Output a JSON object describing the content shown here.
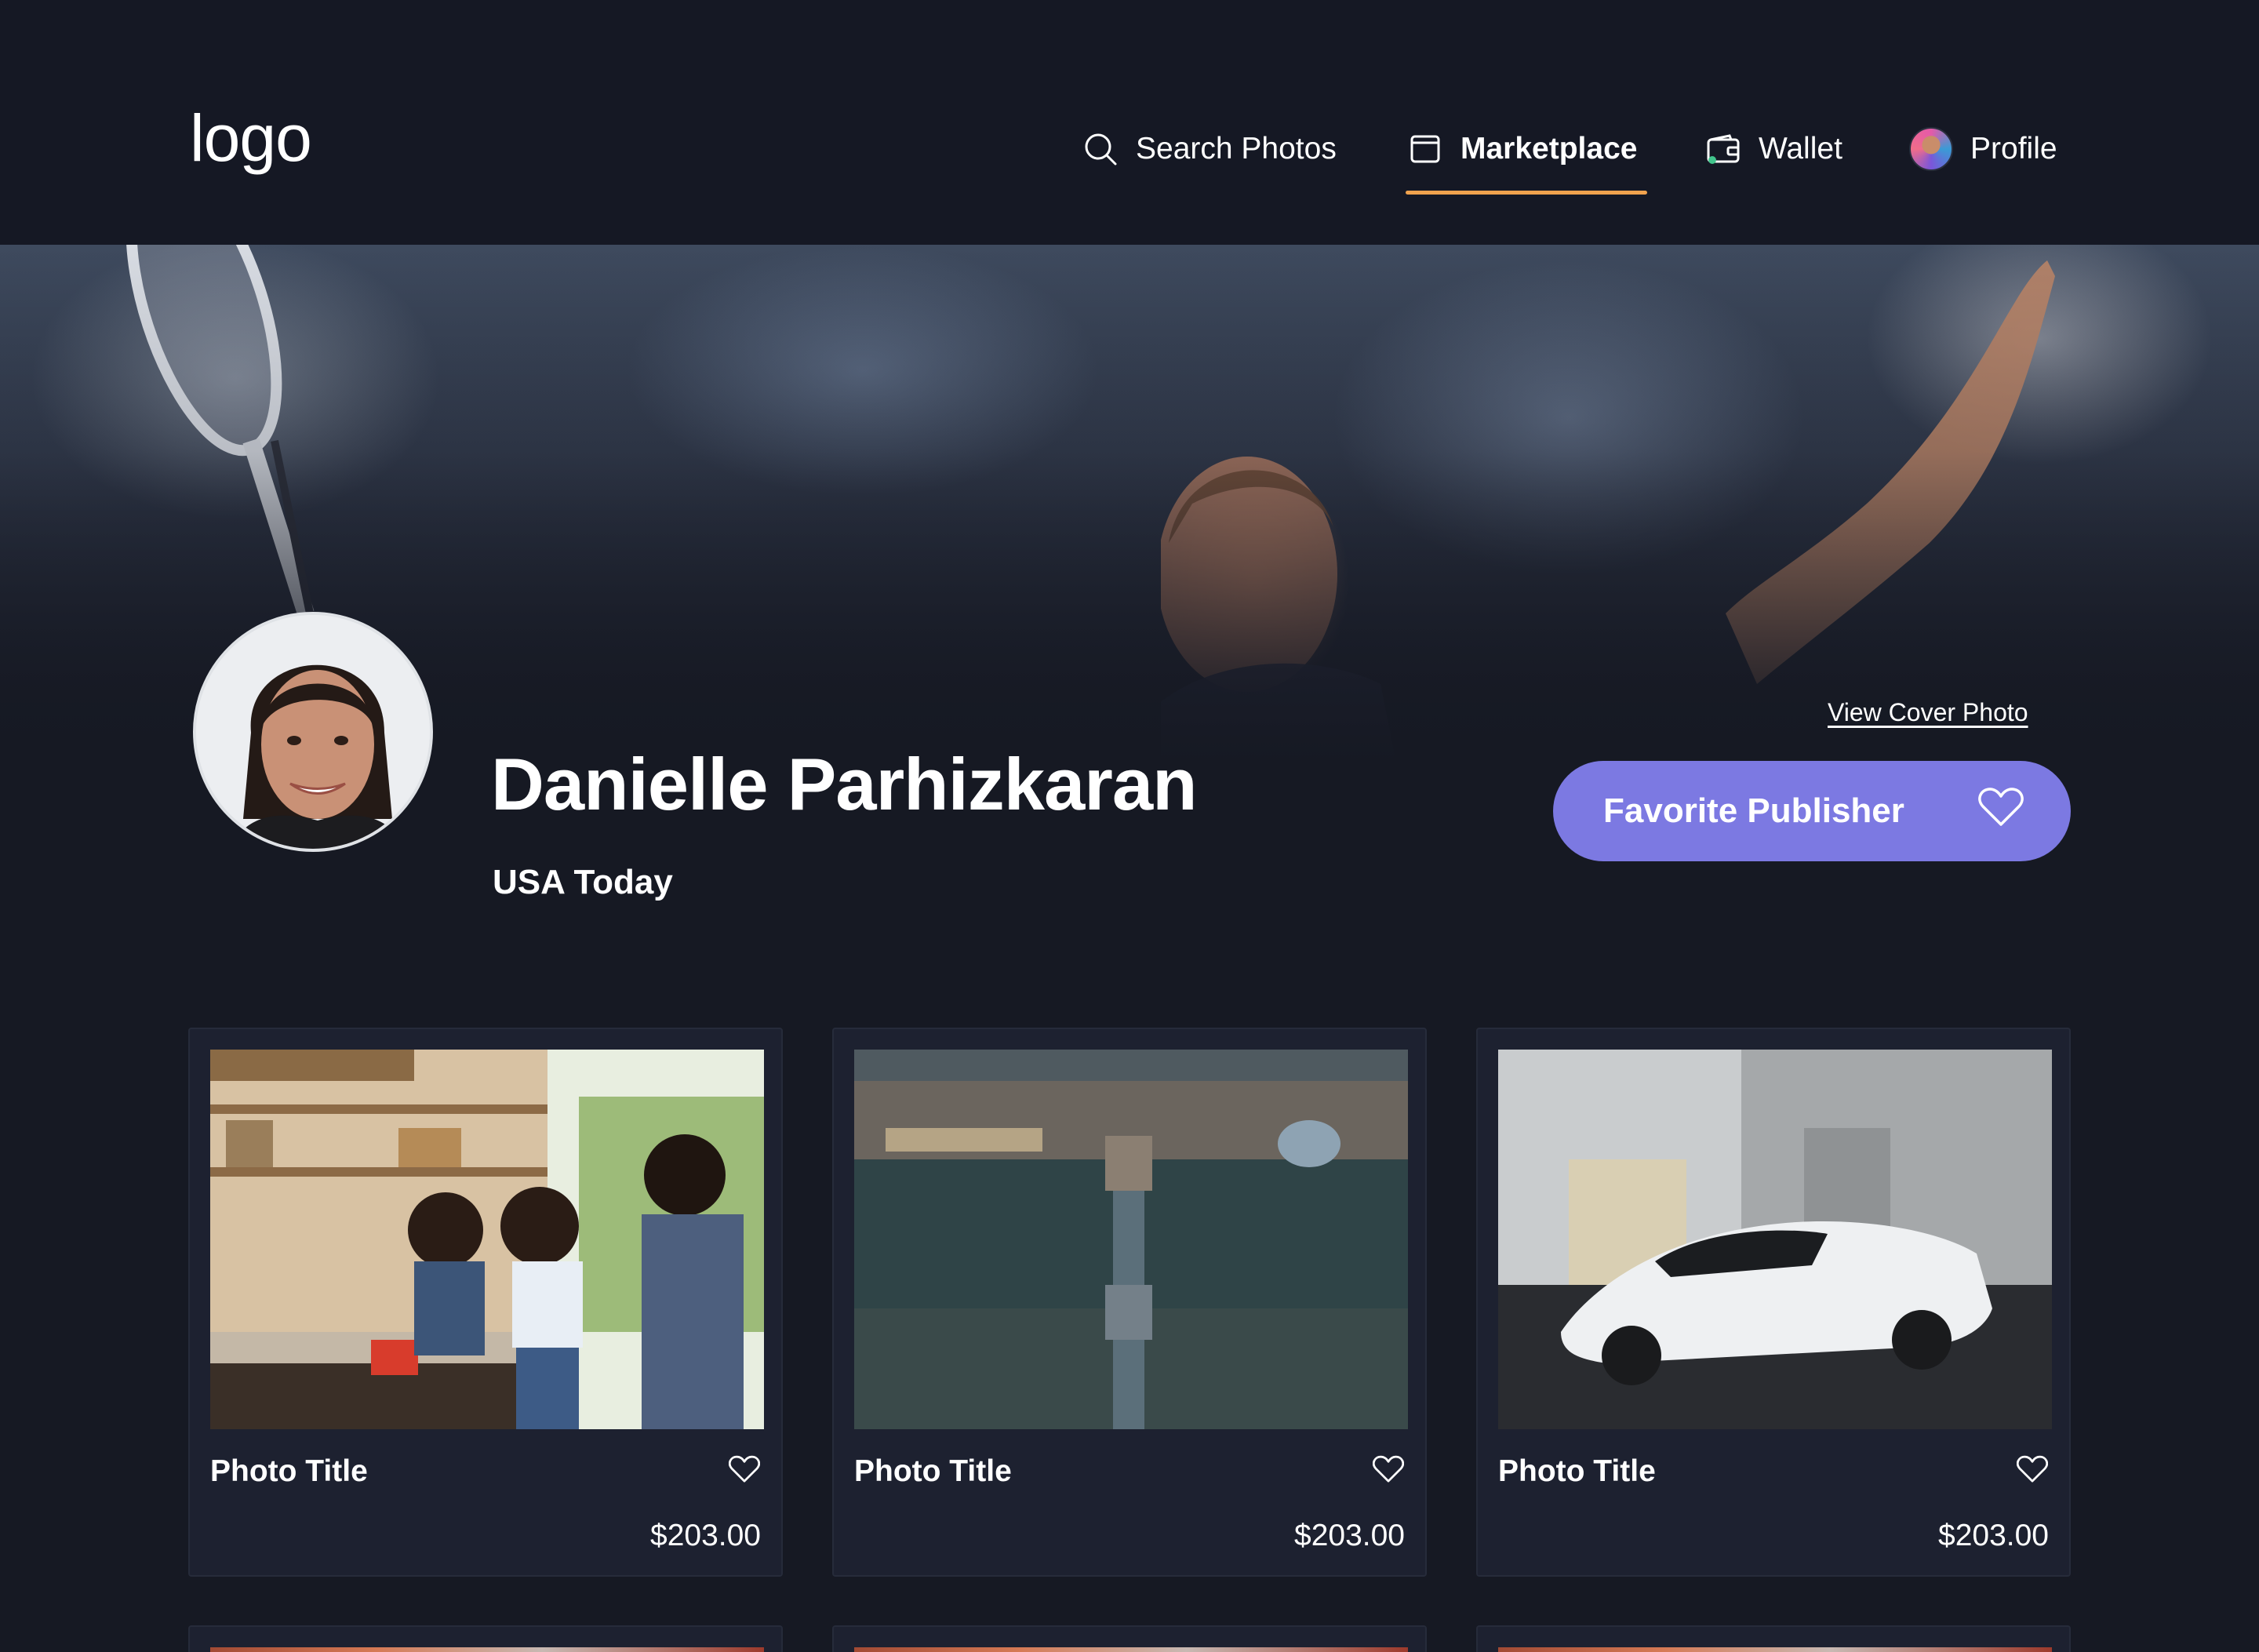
{
  "header": {
    "logo": "logo",
    "nav": [
      {
        "label": "Search Photos",
        "icon": "search-icon",
        "active": false
      },
      {
        "label": "Marketplace",
        "icon": "marketplace-icon",
        "active": true
      },
      {
        "label": "Wallet",
        "icon": "wallet-icon",
        "active": false
      },
      {
        "label": "Profile",
        "icon": "avatar",
        "active": false
      }
    ],
    "active_underline_color": "#f0a24e"
  },
  "cover": {
    "view_link": "View Cover Photo"
  },
  "publisher": {
    "name": "Danielle Parhizkaran",
    "organization": "USA Today",
    "favorite_button": "Favorite Publisher",
    "accent_color": "#7c79e2"
  },
  "photos": [
    {
      "title": "Photo Title",
      "price": "$203.00",
      "subject": "family-kitchen"
    },
    {
      "title": "Photo Title",
      "price": "$203.00",
      "subject": "tower-bridge-aerial"
    },
    {
      "title": "Photo Title",
      "price": "$203.00",
      "subject": "white-sports-car"
    }
  ],
  "colors": {
    "background": "#161923",
    "card": "#1d2130"
  }
}
